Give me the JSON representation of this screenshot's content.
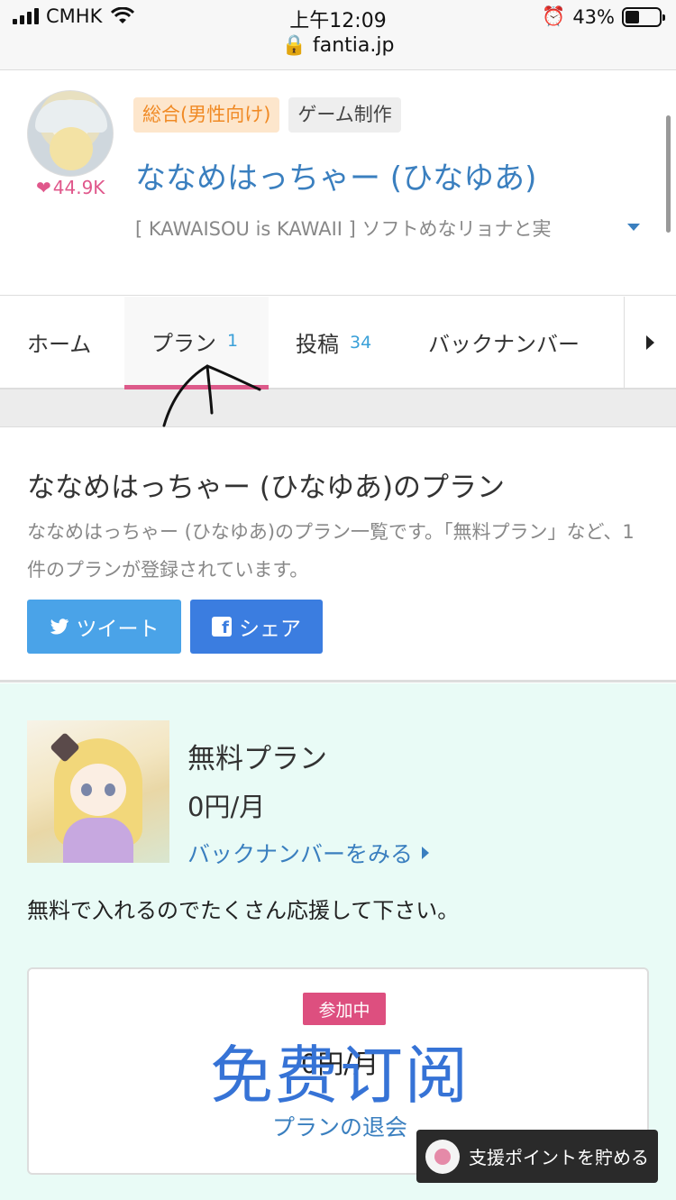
{
  "status_bar": {
    "carrier": "CMHK",
    "time": "上午12:09",
    "url": "fantia.jp",
    "battery": "43%",
    "battery_level": 0.43
  },
  "creator": {
    "likes": "44.9K",
    "tags": [
      "総合(男性向け)",
      "ゲーム制作"
    ],
    "name": "ななめはっちゃー (ひなゆあ)",
    "catchphrase": "[ KAWAISOU is KAWAII ] ソフトめなリョナと実"
  },
  "tabs": {
    "home": "ホーム",
    "plan": "プラン",
    "plan_count": "1",
    "posts": "投稿",
    "posts_count": "34",
    "backnumber": "バックナンバー"
  },
  "intro": {
    "title": "ななめはっちゃー (ひなゆあ)のプラン",
    "description": "ななめはっちゃー (ひなゆあ)のプラン一覧です。「無料プラン」など、1件のプランが登録されています。",
    "tweet_label": "ツイート",
    "share_label": "シェア"
  },
  "plan": {
    "name": "無料プラン",
    "price": "0円/月",
    "backnumber_link": "バックナンバーをみる",
    "description": "無料で入れるのでたくさん応援して下さい。",
    "joined_badge": "参加中",
    "card_price": "0円/月",
    "overlay_text": "免费订阅",
    "withdraw_link": "プランの退会"
  },
  "support": {
    "label": "支援ポイントを貯める"
  },
  "colors": {
    "accent_blue": "#3a7fbf",
    "tab_underline": "#dd5a8a",
    "plan_background": "#e9fbf6",
    "twitter": "#4aa3e8",
    "facebook": "#3b7de0"
  }
}
